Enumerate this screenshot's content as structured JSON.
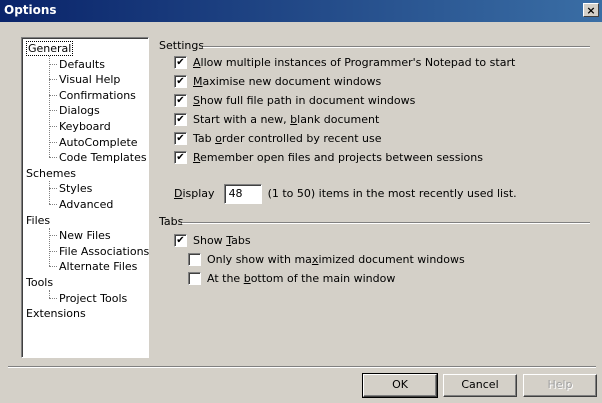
{
  "window": {
    "title": "Options",
    "close_glyph": "×",
    "close_icon": "close-icon"
  },
  "tree": {
    "items": [
      {
        "label": "General",
        "level": 0
      },
      {
        "label": "Defaults",
        "level": 1
      },
      {
        "label": "Visual Help",
        "level": 1
      },
      {
        "label": "Confirmations",
        "level": 1
      },
      {
        "label": "Dialogs",
        "level": 1
      },
      {
        "label": "Keyboard",
        "level": 1
      },
      {
        "label": "AutoComplete",
        "level": 1
      },
      {
        "label": "Code Templates",
        "level": 1
      },
      {
        "label": "Schemes",
        "level": 0
      },
      {
        "label": "Styles",
        "level": 1
      },
      {
        "label": "Advanced",
        "level": 1
      },
      {
        "label": "Files",
        "level": 0
      },
      {
        "label": "New Files",
        "level": 1
      },
      {
        "label": "File Associations",
        "level": 1
      },
      {
        "label": "Alternate Files",
        "level": 1
      },
      {
        "label": "Tools",
        "level": 0
      },
      {
        "label": "Project Tools",
        "level": 1
      },
      {
        "label": "Extensions",
        "level": 0
      }
    ],
    "selected": "General"
  },
  "settings": {
    "group_label": "Settings",
    "checkboxes": [
      {
        "pre": "",
        "key": "A",
        "post": "llow multiple instances of Programmer's Notepad to start",
        "checked": true
      },
      {
        "pre": "",
        "key": "M",
        "post": "aximise new document windows",
        "checked": true
      },
      {
        "pre": "",
        "key": "S",
        "post": "how full file path in document windows",
        "checked": true
      },
      {
        "pre": "Start with a new, ",
        "key": "b",
        "post": "lank document",
        "checked": true
      },
      {
        "pre": "Tab ",
        "key": "o",
        "post": "rder controlled by recent use",
        "checked": true
      },
      {
        "pre": "",
        "key": "R",
        "post": "emember open files and projects between sessions",
        "checked": true
      }
    ],
    "mru": {
      "pre": "",
      "key": "D",
      "post": "isplay",
      "value": "48",
      "suffix": "(1 to 50) items in the most recently used list."
    }
  },
  "tabs": {
    "group_label": "Tabs",
    "checkboxes": [
      {
        "pre": "Show ",
        "key": "T",
        "post": "abs",
        "checked": true,
        "indent": 0
      },
      {
        "pre": "Only show with ma",
        "key": "x",
        "post": "imized document windows",
        "checked": false,
        "indent": 1
      },
      {
        "pre": "At the ",
        "key": "b",
        "post": "ottom of the main window",
        "checked": false,
        "indent": 1
      }
    ]
  },
  "check_glyph": "✔",
  "buttons": {
    "ok": "OK",
    "cancel": "Cancel",
    "help": "Help"
  }
}
